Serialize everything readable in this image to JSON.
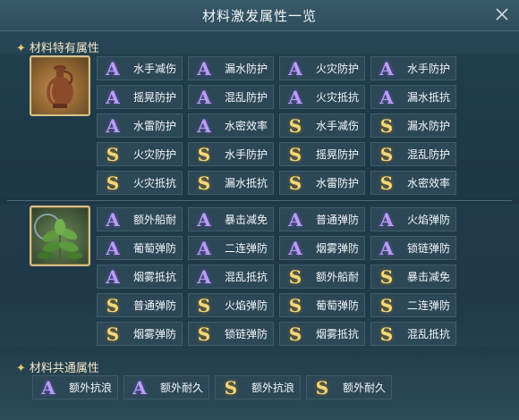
{
  "title": "材料激发属性一览",
  "sections": {
    "special_label": "材料特有属性",
    "common_label": "材料共通属性"
  },
  "materials": [
    {
      "icon": "vase-icon",
      "rows": [
        [
          {
            "grade": "A",
            "label": "水手减伤"
          },
          {
            "grade": "A",
            "label": "漏水防护"
          },
          {
            "grade": "A",
            "label": "火灾防护"
          },
          {
            "grade": "A",
            "label": "水手防护"
          }
        ],
        [
          {
            "grade": "A",
            "label": "摇晃防护"
          },
          {
            "grade": "A",
            "label": "混乱防护"
          },
          {
            "grade": "A",
            "label": "火灾抵抗"
          },
          {
            "grade": "A",
            "label": "漏水抵抗"
          }
        ],
        [
          {
            "grade": "A",
            "label": "水雷防护"
          },
          {
            "grade": "A",
            "label": "水密效率"
          },
          {
            "grade": "S",
            "label": "水手减伤"
          },
          {
            "grade": "S",
            "label": "漏水防护"
          }
        ],
        [
          {
            "grade": "S",
            "label": "火灾防护"
          },
          {
            "grade": "S",
            "label": "水手防护"
          },
          {
            "grade": "S",
            "label": "摇晃防护"
          },
          {
            "grade": "S",
            "label": "混乱防护"
          }
        ],
        [
          {
            "grade": "S",
            "label": "火灾抵抗"
          },
          {
            "grade": "S",
            "label": "漏水抵抗"
          },
          {
            "grade": "S",
            "label": "水雷防护"
          },
          {
            "grade": "S",
            "label": "水密效率"
          }
        ]
      ]
    },
    {
      "icon": "herb-plant-icon",
      "rows": [
        [
          {
            "grade": "A",
            "label": "额外船耐"
          },
          {
            "grade": "A",
            "label": "暴击减免"
          },
          {
            "grade": "A",
            "label": "普通弹防"
          },
          {
            "grade": "A",
            "label": "火焰弹防"
          }
        ],
        [
          {
            "grade": "A",
            "label": "葡萄弹防"
          },
          {
            "grade": "A",
            "label": "二连弹防"
          },
          {
            "grade": "A",
            "label": "烟雾弹防"
          },
          {
            "grade": "A",
            "label": "锁链弹防"
          }
        ],
        [
          {
            "grade": "A",
            "label": "烟雾抵抗"
          },
          {
            "grade": "A",
            "label": "混乱抵抗"
          },
          {
            "grade": "S",
            "label": "额外船耐"
          },
          {
            "grade": "S",
            "label": "暴击减免"
          }
        ],
        [
          {
            "grade": "S",
            "label": "普通弹防"
          },
          {
            "grade": "S",
            "label": "火焰弹防"
          },
          {
            "grade": "S",
            "label": "葡萄弹防"
          },
          {
            "grade": "S",
            "label": "二连弹防"
          }
        ],
        [
          {
            "grade": "S",
            "label": "烟雾弹防"
          },
          {
            "grade": "S",
            "label": "锁链弹防"
          },
          {
            "grade": "S",
            "label": "烟雾抵抗"
          },
          {
            "grade": "S",
            "label": "混乱抵抗"
          }
        ]
      ]
    }
  ],
  "common": [
    {
      "grade": "A",
      "label": "额外抗浪"
    },
    {
      "grade": "A",
      "label": "额外耐久"
    },
    {
      "grade": "S",
      "label": "额外抗浪"
    },
    {
      "grade": "S",
      "label": "额外耐久"
    }
  ],
  "colors": {
    "grade_A": "#b99cf4",
    "grade_S": "#f3d77a",
    "accent_gold": "#e3c879"
  }
}
